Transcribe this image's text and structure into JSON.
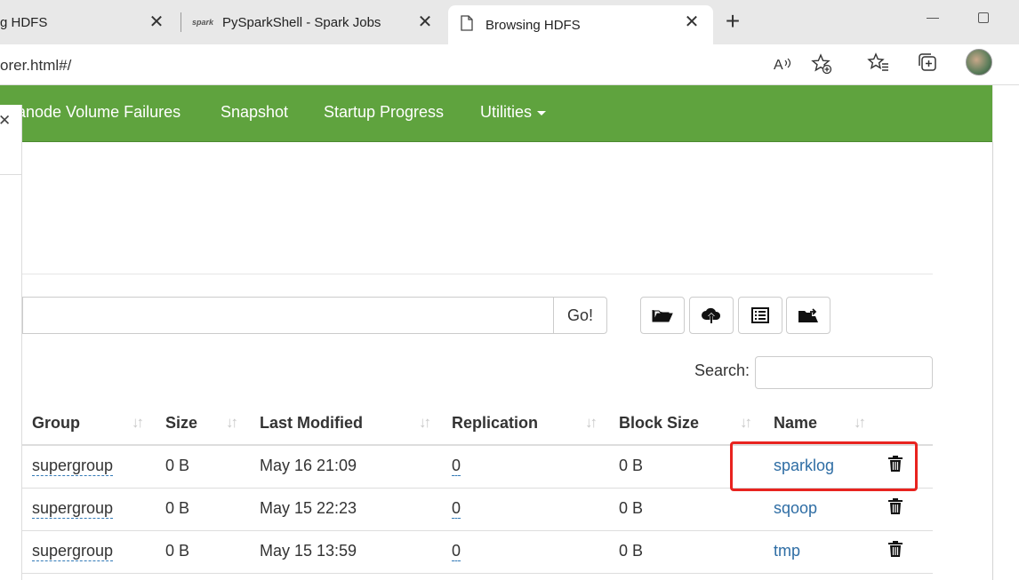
{
  "browser": {
    "tabs": [
      {
        "title": "g HDFS",
        "close": "✕"
      },
      {
        "title": "PySparkShell - Spark Jobs",
        "close": "✕"
      },
      {
        "title": "Browsing HDFS",
        "close": "✕"
      }
    ],
    "new_tab": "+",
    "address": "orer.html#/"
  },
  "navbar": {
    "items": [
      {
        "label": "anode Volume Failures"
      },
      {
        "label": "Snapshot"
      },
      {
        "label": "Startup Progress"
      },
      {
        "label": "Utilities"
      }
    ]
  },
  "side_panel": {
    "close": "✕"
  },
  "toolbar": {
    "go_label": "Go!",
    "path_value": ""
  },
  "search": {
    "label": "Search:",
    "value": ""
  },
  "table": {
    "headers": [
      "Group",
      "Size",
      "Last Modified",
      "Replication",
      "Block Size",
      "Name"
    ],
    "rows": [
      {
        "group": "supergroup",
        "size": "0 B",
        "modified": "May 16 21:09",
        "replication": "0",
        "block_size": "0 B",
        "name": "sparklog"
      },
      {
        "group": "supergroup",
        "size": "0 B",
        "modified": "May 15 22:23",
        "replication": "0",
        "block_size": "0 B",
        "name": "sqoop"
      },
      {
        "group": "supergroup",
        "size": "0 B",
        "modified": "May 15 13:59",
        "replication": "0",
        "block_size": "0 B",
        "name": "tmp"
      }
    ]
  },
  "colors": {
    "navbar": "#5fa33e",
    "link": "#2e6da4",
    "highlight": "#e8231f"
  }
}
